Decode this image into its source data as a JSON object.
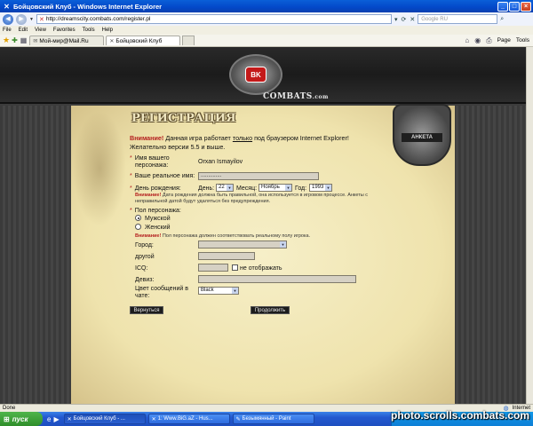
{
  "window": {
    "title": "Бойцовский Клуб - Windows Internet Explorer"
  },
  "address": {
    "url": "http://dreamscity.combats.com/register.pl",
    "search_placeholder": "Google RU"
  },
  "menu": [
    "File",
    "Edit",
    "View",
    "Favorites",
    "Tools",
    "Help"
  ],
  "tabs": [
    {
      "label": "Мой-мир@Mail.Ru"
    },
    {
      "label": "Бойцовский Клуб"
    }
  ],
  "commands": {
    "page": "Page",
    "tools": "Tools"
  },
  "site": {
    "logo_text": "COMBATS",
    "logo_sub": ".com",
    "logo_core": "BK",
    "badge_label": "АНКЕТА"
  },
  "page": {
    "title": "РЕГИСТРАЦИЯ",
    "warning_head": "Внимание!",
    "warning_pre": " Данная игра работает ",
    "warning_u": "только",
    "warning_post": " под браузером Internet Explorer! Желательно версии 5.5 и выше."
  },
  "form": {
    "name_label_1": "Имя вашего",
    "name_label_2": "персонажа:",
    "name_value": "Orxan Ismayilov",
    "realname_label": "Ваше реальное имя:",
    "realname_value": "..............",
    "birth_label": "День рождения:",
    "day_label": "День:",
    "day_value": "22",
    "month_label": "Месяц:",
    "month_value": "Ноябрь",
    "year_label": "Год:",
    "year_value": "1993",
    "birth_note_head": "Внимание!",
    "birth_note_1": " Дата рождения должна быть правильной, она используется в игровом процессе. Анкеты с",
    "birth_note_2": "неправильной датой будут удаляться без предупреждения.",
    "gender_label": "Пол персонажа:",
    "gender_male": "Мужской",
    "gender_female": "Женский",
    "gender_note_head": "Внимание!",
    "gender_note": " Пол персонажа должен соответствовать реальному полу игрока.",
    "city_label": "Город:",
    "other_label": "другой",
    "icq_label": "ICQ:",
    "icq_hide": "не отображать",
    "motto_label": "Девиз:",
    "color_label_1": "Цвет сообщений в",
    "color_label_2": "чате:",
    "color_value": "Black",
    "back_button": "Вернуться",
    "continue_button": "Продолжить"
  },
  "status": {
    "left": "Done",
    "zone": "Internet"
  },
  "taskbar": {
    "start": "пуск",
    "tasks": [
      "Бойцовский Клуб - ...",
      "1: Www.BiG.aZ - Hus...",
      "Безымянный - Paint"
    ]
  },
  "watermark": "photo.scrolls.combats.com"
}
